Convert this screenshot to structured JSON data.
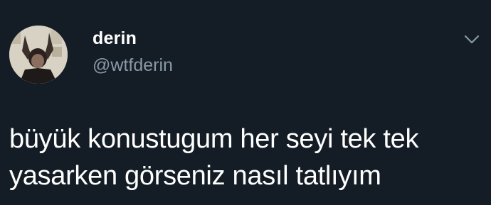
{
  "tweet": {
    "author": {
      "display_name": "derin",
      "handle": "@wtfderin"
    },
    "text_lines": [
      "büyük konustugum her seyi tek tek",
      "yasarken görseniz nasıl tatlıyım"
    ],
    "menu_icon": "chevron-down-icon",
    "colors": {
      "background": "#141d26",
      "primary_text": "#ffffff",
      "secondary_text": "#8899a6"
    }
  }
}
